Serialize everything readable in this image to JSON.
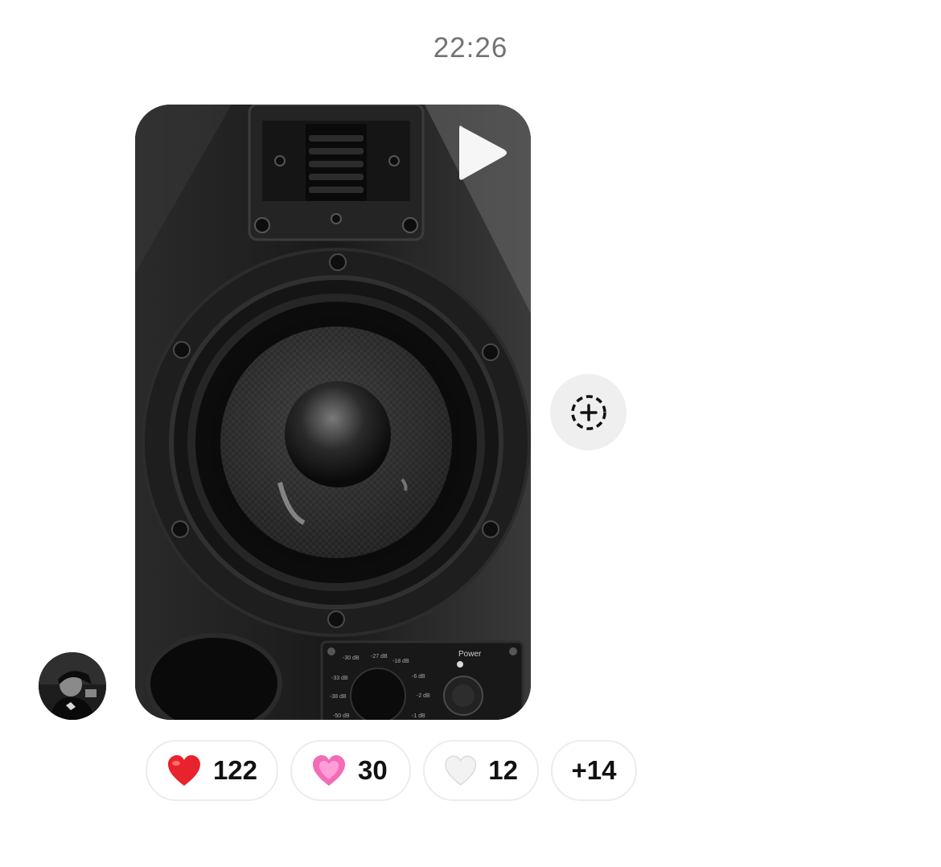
{
  "timestamp": "22:26",
  "message": {
    "media_type": "video",
    "subject": "studio monitor speaker",
    "panel_labels": {
      "power": "Power",
      "db_marks": [
        "-30 dB",
        "-27 dB",
        "-18 dB",
        "-33 dB",
        "-6 dB",
        "-38 dB",
        "-2 dB",
        "-50 dB",
        "-1 dB"
      ]
    }
  },
  "reactions": [
    {
      "emoji": "red-heart",
      "count": "122",
      "color": "#e8232d"
    },
    {
      "emoji": "pink-heart",
      "count": "30",
      "color": "#f36cb7"
    },
    {
      "emoji": "white-heart",
      "count": "12",
      "color": "#f2f2f2"
    }
  ],
  "more_reactions": "+14"
}
